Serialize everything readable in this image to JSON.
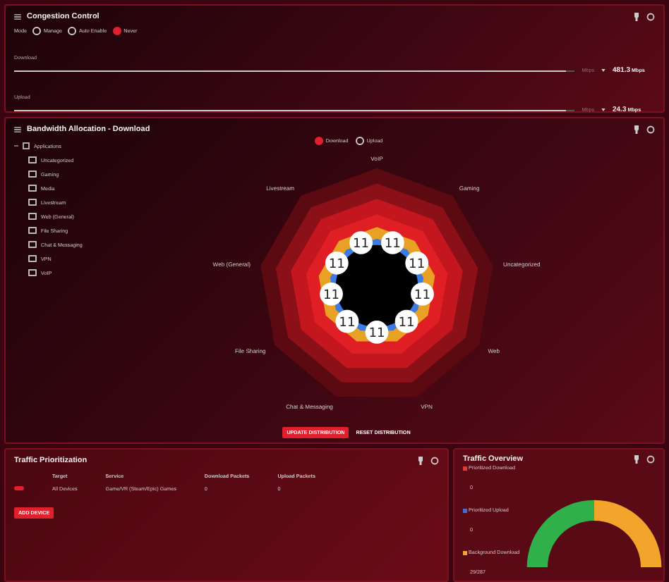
{
  "congestion": {
    "title": "Congestion Control",
    "mode_label": "Mode",
    "modes": [
      {
        "label": "Manage",
        "selected": false
      },
      {
        "label": "Auto Enable",
        "selected": false
      },
      {
        "label": "Never",
        "selected": true
      }
    ],
    "sliders": [
      {
        "label": "Download",
        "level": 0.985,
        "unit_hint": "Mbps",
        "value": "481.3",
        "unit": "Mbps"
      },
      {
        "label": "Upload",
        "level": 0.985,
        "unit_hint": "Mbps",
        "value": "24.3",
        "unit": "Mbps"
      }
    ]
  },
  "allocation": {
    "title": "Bandwidth Allocation - Download",
    "root": {
      "label": "Applications",
      "expanded": true,
      "children": [
        {
          "label": "Uncategorized"
        },
        {
          "label": "Gaming"
        },
        {
          "label": "Media"
        },
        {
          "label": "Livestream"
        },
        {
          "label": "Web (General)"
        },
        {
          "label": "File Sharing"
        },
        {
          "label": "Chat & Messaging"
        },
        {
          "label": "VPN"
        },
        {
          "label": "VoIP"
        }
      ]
    },
    "legend": [
      {
        "label": "Download",
        "selected": true
      },
      {
        "label": "Upload",
        "selected": false
      }
    ],
    "spokes": [
      "VoIP",
      "Gaming",
      "Uncategorized",
      "Web",
      "VPN",
      "Chat & Messaging",
      "File Sharing",
      "Web (General)",
      "Livestream"
    ],
    "badges": [
      "11",
      "11",
      "11",
      "11",
      "11",
      "11",
      "11",
      "11",
      "11"
    ],
    "buttons": [
      {
        "label": "UPDATE DISTRIBUTION",
        "kind": "primary"
      },
      {
        "label": "RESET DISTRIBUTION",
        "kind": "text"
      }
    ]
  },
  "prioritization": {
    "title": "Traffic Prioritization",
    "columns": [
      "Target",
      "Service",
      "Download Packets",
      "Upload Packets"
    ],
    "rows": [
      {
        "on": true,
        "target": "All Devices",
        "service": "Game/VR (Steam/Epic) Games",
        "download": "0",
        "upload": "0"
      }
    ],
    "add_button": "ADD DEVICE"
  },
  "overview": {
    "title": "Traffic Overview",
    "legend": [
      {
        "label": "Prioritized Download",
        "value": "0",
        "color": "#e53935"
      },
      {
        "label": "Prioritized Upload",
        "value": "0",
        "color": "#3f6fd8"
      },
      {
        "label": "Background Download",
        "value": "29/287",
        "color": "#f2a52a"
      }
    ]
  }
}
